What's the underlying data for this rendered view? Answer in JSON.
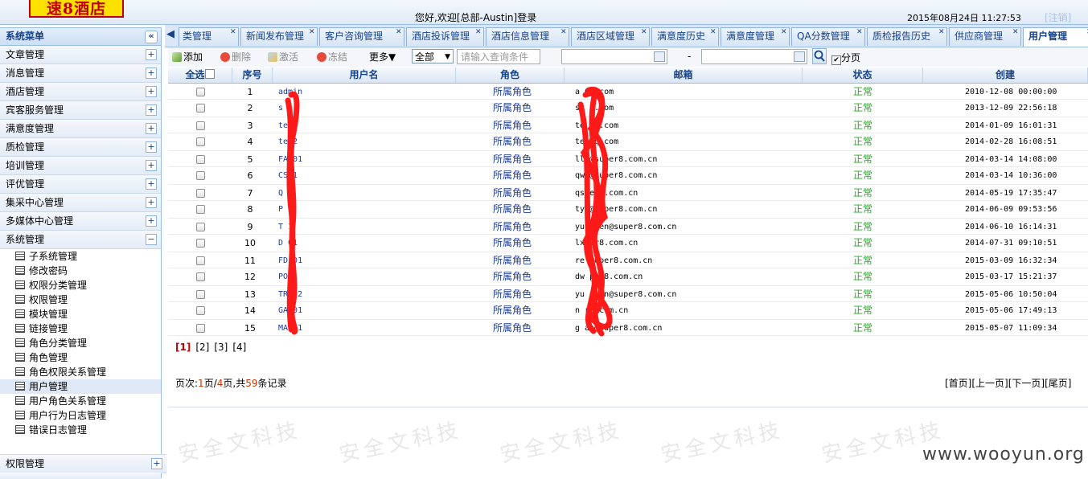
{
  "header": {
    "logo": "速8酒店",
    "welcome": "您好,欢迎[总部-Austin]登录",
    "datetime": "2015年08月24日 11:27:53",
    "logout": "[注销]"
  },
  "sidebar": {
    "title": "系统菜单",
    "collapse_symbol": "«",
    "items": [
      {
        "label": "文章管理",
        "toggle": "+"
      },
      {
        "label": "消息管理",
        "toggle": "+"
      },
      {
        "label": "酒店管理",
        "toggle": "+"
      },
      {
        "label": "宾客服务管理",
        "toggle": "+"
      },
      {
        "label": "满意度管理",
        "toggle": "+"
      },
      {
        "label": "质检管理",
        "toggle": "+"
      },
      {
        "label": "培训管理",
        "toggle": "+"
      },
      {
        "label": "评优管理",
        "toggle": "+"
      },
      {
        "label": "集采中心管理",
        "toggle": "+"
      },
      {
        "label": "多媒体中心管理",
        "toggle": "+"
      },
      {
        "label": "系统管理",
        "toggle": "−"
      }
    ],
    "sub_items": [
      "子系统管理",
      "修改密码",
      "权限分类管理",
      "权限管理",
      "模块管理",
      "链接管理",
      "角色分类管理",
      "角色管理",
      "角色权限关系管理",
      "用户管理",
      "用户角色关系管理",
      "用户行为日志管理",
      "错误日志管理"
    ],
    "active_sub": "用户管理",
    "bottom_item": {
      "label": "权限管理",
      "toggle": "+"
    }
  },
  "tabs": [
    {
      "label": "类管理"
    },
    {
      "label": "新闻发布管理"
    },
    {
      "label": "客户咨询管理"
    },
    {
      "label": "酒店投诉管理"
    },
    {
      "label": "酒店信息管理"
    },
    {
      "label": "酒店区域管理"
    },
    {
      "label": "满意度历史"
    },
    {
      "label": "满意度管理"
    },
    {
      "label": "QA分数管理"
    },
    {
      "label": "质检报告历史"
    },
    {
      "label": "供应商管理"
    },
    {
      "label": "用户管理"
    }
  ],
  "active_tab": "用户管理",
  "toolbar": {
    "add": "添加",
    "delete": "删除",
    "activate": "激活",
    "freeze": "冻结",
    "more": "更多▼",
    "scope": "全部",
    "query_placeholder": "请输入查询条件",
    "range_sep": "-",
    "paging": "分页"
  },
  "columns": [
    "全选",
    "序号",
    "用户名",
    "角色",
    "邮箱",
    "状态",
    "创建"
  ],
  "rows": [
    {
      "seq": "1",
      "user": "admin",
      "role": "所属角色",
      "mail": "a 63.com",
      "status": "正常",
      "created": "2010-12-08 00:00:00"
    },
    {
      "seq": "2",
      "user": "s",
      "role": "所属角色",
      "mail": "sv 3.com",
      "status": "正常",
      "created": "2013-12-09 22:56:18"
    },
    {
      "seq": "3",
      "user": "te 1",
      "role": "所属角色",
      "mail": "te 63.com",
      "status": "正常",
      "created": "2014-01-09 16:01:31"
    },
    {
      "seq": "4",
      "user": "te 2",
      "role": "所属角色",
      "mail": "te qq.com",
      "status": "正常",
      "created": "2014-02-28 16:08:51"
    },
    {
      "seq": "5",
      "user": "FA 01",
      "role": "所属角色",
      "mail": "ll @super8.com.cn",
      "status": "正常",
      "created": "2014-03-14 14:08:00"
    },
    {
      "seq": "6",
      "user": "CS 1",
      "role": "所属角色",
      "mail": "qw @super8.com.cn",
      "status": "正常",
      "created": "2014-03-14 10:36:00"
    },
    {
      "seq": "7",
      "user": "Q 1",
      "role": "所属角色",
      "mail": "qs er8.com.cn",
      "status": "正常",
      "created": "2014-05-19 17:35:47"
    },
    {
      "seq": "8",
      "user": "P 1",
      "role": "所属角色",
      "mail": "ty @super8.com.cn",
      "status": "正常",
      "created": "2014-06-09 09:53:56"
    },
    {
      "seq": "9",
      "user": "T 1",
      "role": "所属角色",
      "mail": "yu gwen@super8.com.cn",
      "status": "正常",
      "created": "2014-06-10 16:14:31"
    },
    {
      "seq": "10",
      "user": "D 01",
      "role": "所属角色",
      "mail": "lx er8.com.cn",
      "status": "正常",
      "created": "2014-07-31 09:10:51"
    },
    {
      "seq": "11",
      "user": "FD 01",
      "role": "所属角色",
      "mail": "re super8.com.cn",
      "status": "正常",
      "created": "2015-03-09 16:32:34"
    },
    {
      "seq": "12",
      "user": "PO 1",
      "role": "所属角色",
      "mail": "dw per8.com.cn",
      "status": "正常",
      "created": "2015-03-17 15:21:37"
    },
    {
      "seq": "13",
      "user": "TR 02",
      "role": "所属角色",
      "mail": "yu gwen@super8.com.cn",
      "status": "正常",
      "created": "2015-05-06 10:50:04"
    },
    {
      "seq": "14",
      "user": "GA 01",
      "role": "所属角色",
      "mail": "n r8.com.cn",
      "status": "正常",
      "created": "2015-05-06 17:49:13"
    },
    {
      "seq": "15",
      "user": "MA 01",
      "role": "所属角色",
      "mail": "g an@super8.com.cn",
      "status": "正常",
      "created": "2015-05-07 11:09:34"
    }
  ],
  "pages": [
    "[1]",
    "[2]",
    "[3]",
    "[4]"
  ],
  "page_info": {
    "prefix": "页次:",
    "current": "1",
    "mid": "页/",
    "total_pages": "4",
    "mid2": "页,共",
    "records": "59",
    "suffix": "条记录"
  },
  "nav": {
    "first": "[首页]",
    "prev": "[上一页]",
    "next": "[下一页]",
    "last": "[尾页]"
  },
  "watermark": {
    "text": "安全文科技",
    "site": "www.wooyun.org"
  },
  "colors": {
    "header_blue": "#15428b",
    "status_green": "#22aa22",
    "redaction_red": "#ff1a1a"
  }
}
